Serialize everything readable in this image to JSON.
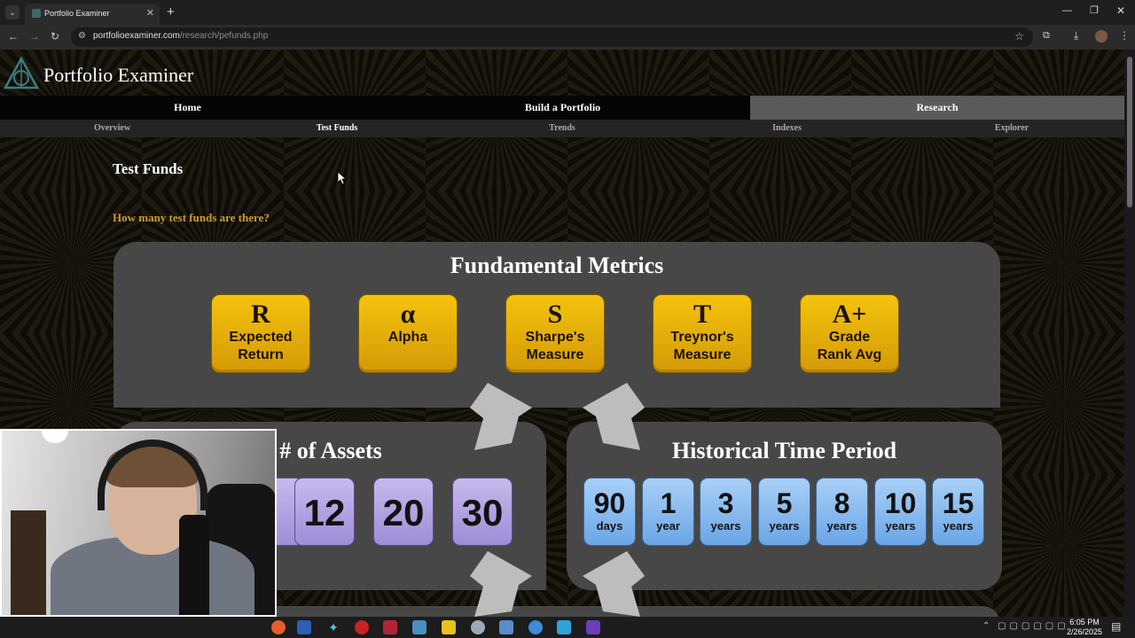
{
  "browser": {
    "tab_title": "Portfolio Examiner",
    "url_host": "portfolioexaminer.com",
    "url_path": "/research/pefunds.php"
  },
  "site": {
    "name": "Portfolio Examiner",
    "main_nav": [
      "Home",
      "Build a Portfolio",
      "Research"
    ],
    "sub_nav": [
      "Overview",
      "Test Funds",
      "Trends",
      "Indexes",
      "Explorer"
    ]
  },
  "content": {
    "title": "Test Funds",
    "question": "How many test funds are there?"
  },
  "fundamental_metrics": {
    "title": "Fundamental Metrics",
    "items": [
      {
        "symbol": "R",
        "line1": "Expected",
        "line2": "Return"
      },
      {
        "symbol": "α",
        "line1": "Alpha",
        "line2": ""
      },
      {
        "symbol": "S",
        "line1": "Sharpe's",
        "line2": "Measure"
      },
      {
        "symbol": "T",
        "line1": "Treynor's",
        "line2": "Measure"
      },
      {
        "symbol": "A+",
        "line1": "Grade",
        "line2": "Rank Avg"
      }
    ]
  },
  "assets": {
    "title": "# of Assets",
    "values": [
      "12",
      "20",
      "30"
    ]
  },
  "time_period": {
    "title": "Historical Time Period",
    "items": [
      {
        "n": "90",
        "u": "days"
      },
      {
        "n": "1",
        "u": "year"
      },
      {
        "n": "3",
        "u": "years"
      },
      {
        "n": "5",
        "u": "years"
      },
      {
        "n": "8",
        "u": "years"
      },
      {
        "n": "10",
        "u": "years"
      },
      {
        "n": "15",
        "u": "years"
      }
    ]
  },
  "taskbar": {
    "time": "6:05 PM",
    "date": "2/26/2025"
  },
  "colors": {
    "gold": "#f4c30d",
    "purple": "#b8a8e6",
    "blue": "#8fbdf1",
    "question": "#c99a36",
    "panel": "#474747"
  }
}
